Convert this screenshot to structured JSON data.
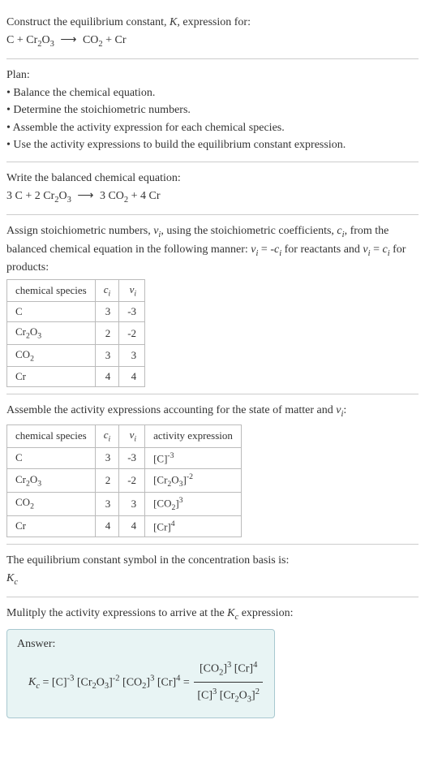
{
  "intro": {
    "line1": "Construct the equilibrium constant, K, expression for:",
    "equation": "C + Cr₂O₃ ⟶ CO₂ + Cr"
  },
  "plan": {
    "heading": "Plan:",
    "bullets": [
      "• Balance the chemical equation.",
      "• Determine the stoichiometric numbers.",
      "• Assemble the activity expression for each chemical species.",
      "• Use the activity expressions to build the equilibrium constant expression."
    ]
  },
  "balanced": {
    "heading": "Write the balanced chemical equation:",
    "equation": "3 C + 2 Cr₂O₃ ⟶ 3 CO₂ + 4 Cr"
  },
  "stoich": {
    "text": "Assign stoichiometric numbers, νᵢ, using the stoichiometric coefficients, cᵢ, from the balanced chemical equation in the following manner: νᵢ = -cᵢ for reactants and νᵢ = cᵢ for products:",
    "headers": [
      "chemical species",
      "cᵢ",
      "νᵢ"
    ],
    "rows": [
      {
        "species": "C",
        "c": "3",
        "v": "-3"
      },
      {
        "species": "Cr₂O₃",
        "c": "2",
        "v": "-2"
      },
      {
        "species": "CO₂",
        "c": "3",
        "v": "3"
      },
      {
        "species": "Cr",
        "c": "4",
        "v": "4"
      }
    ]
  },
  "activity": {
    "text": "Assemble the activity expressions accounting for the state of matter and νᵢ:",
    "headers": [
      "chemical species",
      "cᵢ",
      "νᵢ",
      "activity expression"
    ],
    "rows": [
      {
        "species": "C",
        "c": "3",
        "v": "-3",
        "expr": "[C]⁻³"
      },
      {
        "species": "Cr₂O₃",
        "c": "2",
        "v": "-2",
        "expr": "[Cr₂O₃]⁻²"
      },
      {
        "species": "CO₂",
        "c": "3",
        "v": "3",
        "expr": "[CO₂]³"
      },
      {
        "species": "Cr",
        "c": "4",
        "v": "4",
        "expr": "[Cr]⁴"
      }
    ]
  },
  "symbol": {
    "text": "The equilibrium constant symbol in the concentration basis is:",
    "value": "K_c"
  },
  "multiply": {
    "text": "Mulitply the activity expressions to arrive at the K_c expression:"
  },
  "answer": {
    "label": "Answer:",
    "lhs": "K_c = [C]⁻³ [Cr₂O₃]⁻² [CO₂]³ [Cr]⁴ = ",
    "num": "[CO₂]³ [Cr]⁴",
    "den": "[C]³ [Cr₂O₃]²"
  },
  "chart_data": {
    "type": "table",
    "tables": [
      {
        "title": "Stoichiometric numbers",
        "headers": [
          "chemical species",
          "c_i",
          "nu_i"
        ],
        "rows": [
          [
            "C",
            3,
            -3
          ],
          [
            "Cr2O3",
            2,
            -2
          ],
          [
            "CO2",
            3,
            3
          ],
          [
            "Cr",
            4,
            4
          ]
        ]
      },
      {
        "title": "Activity expressions",
        "headers": [
          "chemical species",
          "c_i",
          "nu_i",
          "activity expression"
        ],
        "rows": [
          [
            "C",
            3,
            -3,
            "[C]^-3"
          ],
          [
            "Cr2O3",
            2,
            -2,
            "[Cr2O3]^-2"
          ],
          [
            "CO2",
            3,
            3,
            "[CO2]^3"
          ],
          [
            "Cr",
            4,
            4,
            "[Cr]^4"
          ]
        ]
      }
    ],
    "balanced_equation": "3 C + 2 Cr2O3 -> 3 CO2 + 4 Cr",
    "equilibrium_constant": "Kc = [CO2]^3 [Cr]^4 / ([C]^3 [Cr2O3]^2)"
  }
}
